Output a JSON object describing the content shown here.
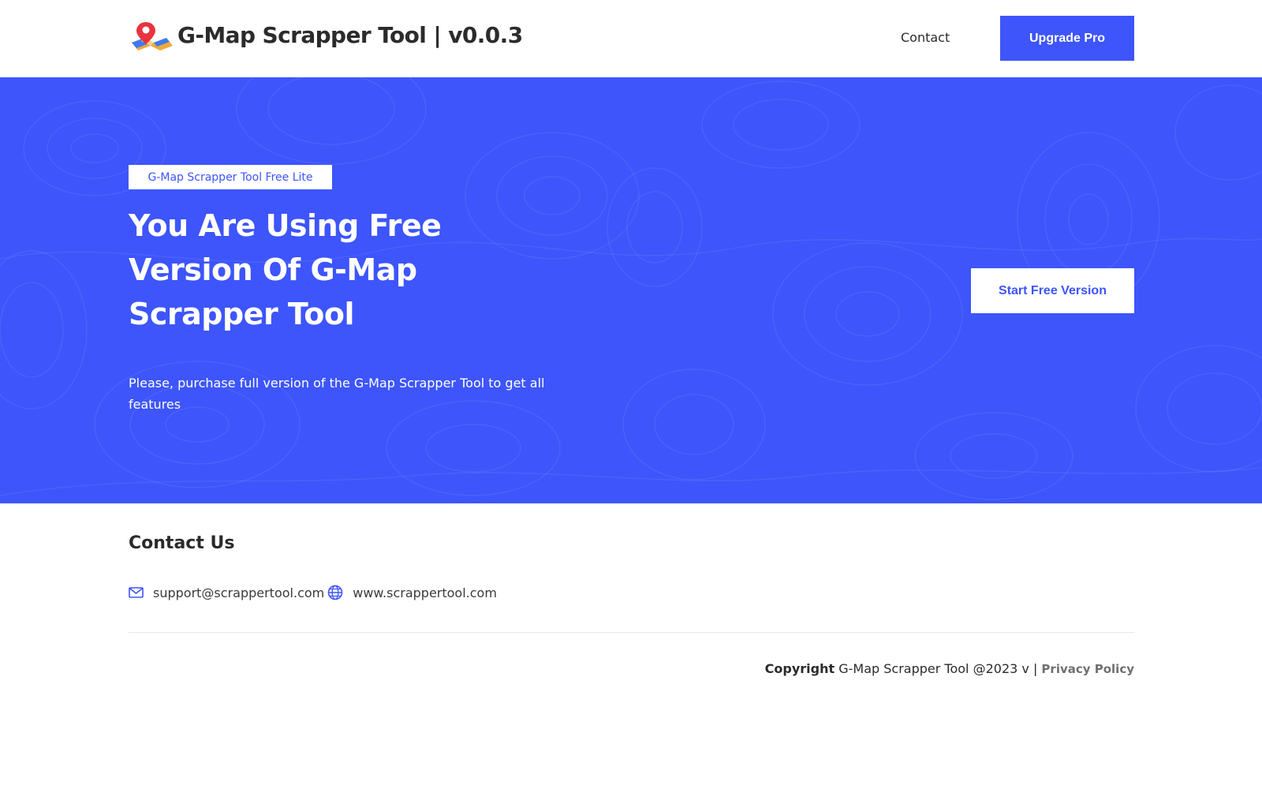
{
  "header": {
    "brand": "G-Map Scrapper Tool | v0.0.3",
    "nav_contact": "Contact",
    "upgrade_label": "Upgrade Pro"
  },
  "hero": {
    "badge": "G-Map Scrapper Tool Free Lite",
    "title": "You Are Using Free Version Of G-Map Scrapper Tool",
    "description": "Please, purchase full version of the G-Map Scrapper Tool to get all features",
    "start_label": "Start Free Version"
  },
  "contact": {
    "title": "Contact Us",
    "email": "support@scrappertool.com",
    "website": "www.scrappertool.com"
  },
  "footer": {
    "copyright_label": "Copyright",
    "copyright_text": " G-Map Scrapper Tool @2023 v | ",
    "privacy": "Privacy Policy"
  },
  "icons": {
    "logo": "map-pin-logo-icon",
    "email": "mail-icon",
    "website": "globe-icon"
  },
  "colors": {
    "accent": "#3d55fb",
    "text": "#2b2b2b",
    "muted": "#707070",
    "background": "#ffffff"
  }
}
